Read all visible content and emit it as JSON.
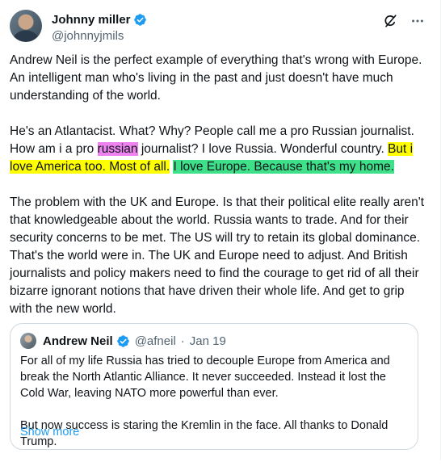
{
  "tweet": {
    "author": {
      "display_name": "Johnny miller",
      "handle": "@johnnyjmils",
      "verified": true
    },
    "actions": {
      "grok_icon": "grok-icon",
      "more_icon": "more-icon"
    },
    "paragraph1": "Andrew Neil is the perfect example of everything that's wrong with Europe. An intelligent man who's living in the past and just doesn't have much understanding of the world.",
    "paragraph2": {
      "part1": "He's an Atlantacist. What? Why? People call me a pro Russian journalist. How am i a pro ",
      "hl_pink": "russian",
      "part2": " journalist? I love Russia. Wonderful country. ",
      "hl_yellow": "But i love America too. Most of all.",
      "space": " ",
      "hl_green": "I love Europe. Because that's my home."
    },
    "paragraph3": "The problem with the UK and Europe. Is that their political elite really aren't that knowledgeable about the world. Russia wants to trade. And for their security concerns to be met. The US will try to retain its global dominance. That's the world were in. The UK and Europe need to adjust. And British journalists and policy makers need to find the courage to get rid of all their bizarre ignorant notions that have driven their whole life. And get to grip with the new world."
  },
  "quote": {
    "display_name": "Andrew Neil",
    "handle": "@afneil",
    "separator": "·",
    "date": "Jan 19",
    "paragraph1": "For all of my life Russia has tried to decouple Europe from America and break the North Atlantic Alliance. It never succeeded. Instead it lost the Cold War, leaving NATO more powerful than ever.",
    "paragraph2": "But now success is staring the Kremlin in the face. All thanks to Donald Trump.",
    "show_more": "Show more"
  },
  "colors": {
    "accent": "#1d9bf0",
    "text": "#0f1419",
    "muted": "#536471",
    "highlight_pink": "#ee82ee",
    "highlight_yellow": "#ffff00",
    "highlight_green": "#3ee08a"
  }
}
